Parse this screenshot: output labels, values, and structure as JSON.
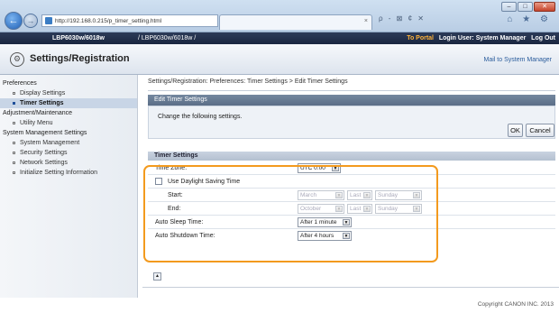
{
  "browser": {
    "url": "http://192.168.0.215/p_timer_setting.html",
    "tab_title": "",
    "window_buttons": [
      "–",
      "□",
      "✕"
    ],
    "search_tools": "ρ - ⊠ ¢ ✕",
    "toolbar_icons": "⌂ ★ ⚙"
  },
  "topbar": {
    "device": "LBP6030w/6018w",
    "device_path": "/ LBP6030w/6018w /",
    "links": {
      "portal": "To Portal",
      "login": "Login User: System Manager",
      "logout": "Log Out"
    }
  },
  "header": {
    "title": "Settings/Registration",
    "mail": "Mail to System Manager"
  },
  "sidebar": {
    "sections": [
      {
        "title": "Preferences",
        "items": [
          "Display Settings",
          "Timer Settings"
        ]
      },
      {
        "title": "Adjustment/Maintenance",
        "items": [
          "Utility Menu"
        ]
      },
      {
        "title": "System Management Settings",
        "items": [
          "System Management",
          "Security Settings",
          "Network Settings",
          "Initialize Setting Information"
        ]
      }
    ],
    "active_item": "Timer Settings"
  },
  "main": {
    "breadcrumb": "Settings/Registration: Preferences: Timer Settings > Edit Timer Settings",
    "panel_title": "Edit Timer Settings",
    "panel_message": "Change the following settings.",
    "ok_label": "OK",
    "cancel_label": "Cancel",
    "section_title": "Timer Settings",
    "rows": {
      "time_zone": {
        "label": "Time Zone:",
        "value": "UTC 0:00"
      },
      "dst": {
        "label": "Use Daylight Saving Time",
        "checked": false
      },
      "start": {
        "label": "Start:",
        "month": "March",
        "week": "Last",
        "day": "Sunday"
      },
      "end": {
        "label": "End:",
        "month": "October",
        "week": "Last",
        "day": "Sunday"
      },
      "auto_sleep": {
        "label": "Auto Sleep Time:",
        "value": "After 1 minute"
      },
      "auto_shutdown": {
        "label": "Auto Shutdown Time:",
        "value": "After 4 hours"
      }
    },
    "highlight_color": "#f39a1e"
  },
  "footer": {
    "copyright": "Copyright CANON INC. 2013"
  }
}
